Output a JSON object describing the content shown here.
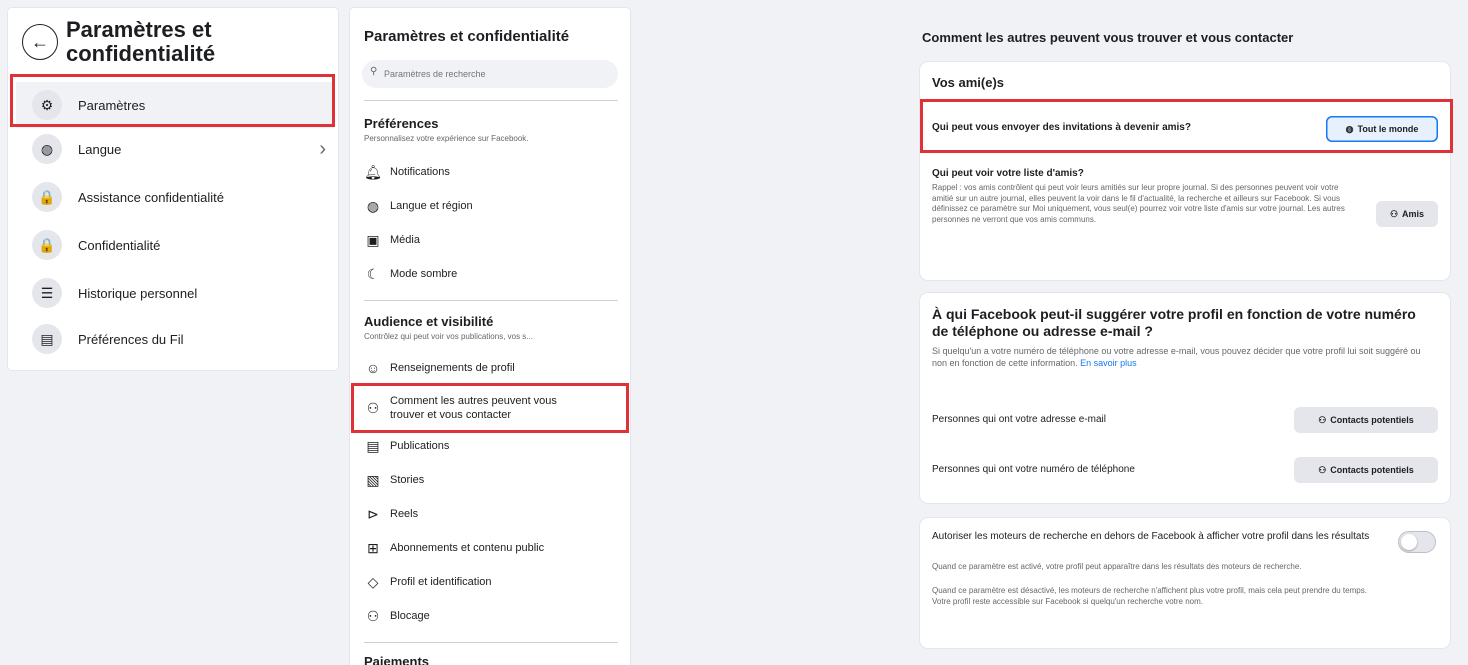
{
  "left": {
    "title": "Paramètres et confidentialité",
    "items": [
      {
        "label": "Paramètres",
        "icon": "gear-icon",
        "glyph": "⚙"
      },
      {
        "label": "Langue",
        "icon": "globe-icon",
        "glyph": "🌐"
      },
      {
        "label": "Assistance confidentialité",
        "icon": "lock-plus-icon",
        "glyph": "🔒"
      },
      {
        "label": "Confidentialité",
        "icon": "lock-icon",
        "glyph": "🔒"
      },
      {
        "label": "Historique personnel",
        "icon": "list-icon",
        "glyph": "☰"
      },
      {
        "label": "Préférences du Fil",
        "icon": "feed-icon",
        "glyph": "▤"
      }
    ]
  },
  "middle": {
    "title": "Paramètres et confidentialité",
    "search_placeholder": "Paramètres de recherche",
    "preferences": {
      "title": "Préférences",
      "subtitle": "Personnalisez votre expérience sur Facebook.",
      "items": [
        {
          "label": "Notifications",
          "icon": "bell-icon",
          "glyph": "🔔"
        },
        {
          "label": "Langue et région",
          "icon": "globe-icon",
          "glyph": "🌐"
        },
        {
          "label": "Média",
          "icon": "media-icon",
          "glyph": "▣"
        },
        {
          "label": "Mode sombre",
          "icon": "moon-icon",
          "glyph": "☾"
        }
      ]
    },
    "audience": {
      "title": "Audience et visibilité",
      "subtitle": "Contrôlez qui peut voir vos publications, vos s...",
      "items": [
        {
          "label": "Renseignements de profil",
          "icon": "profile-icon",
          "glyph": "☺"
        },
        {
          "label": "Comment les autres peuvent vous trouver et vous contacter",
          "icon": "person-add-icon",
          "glyph": "👤"
        },
        {
          "label": "Publications",
          "icon": "posts-icon",
          "glyph": "▤"
        },
        {
          "label": "Stories",
          "icon": "stories-icon",
          "glyph": "▧"
        },
        {
          "label": "Reels",
          "icon": "reels-icon",
          "glyph": "▶"
        },
        {
          "label": "Abonnements et contenu public",
          "icon": "follow-icon",
          "glyph": "⊞"
        },
        {
          "label": "Profil et identification",
          "icon": "tag-icon",
          "glyph": "◇"
        },
        {
          "label": "Blocage",
          "icon": "block-icon",
          "glyph": "👤"
        }
      ]
    },
    "payments": {
      "title": "Paiements"
    }
  },
  "content": {
    "title": "Comment les autres peuvent vous trouver et vous contacter",
    "friends_card": {
      "header": "Vos ami(e)s",
      "q1": "Qui peut vous envoyer des invitations à devenir amis?",
      "q1_value": "Tout le monde",
      "q2": "Qui peut voir votre liste d'amis?",
      "q2_desc": "Rappel : vos amis contrôlent qui peut voir leurs amitiés sur leur propre journal. Si des personnes peuvent voir votre amitié sur un autre journal, elles peuvent la voir dans le fil d'actualité, la recherche et ailleurs sur Facebook. Si vous définissez ce paramètre sur Moi uniquement, vous seul(e) pourrez voir votre liste d'amis sur votre journal. Les autres personnes ne verront que vos amis communs.",
      "q2_value": "Amis"
    },
    "suggest_card": {
      "header": "À qui Facebook peut-il suggérer votre profil en fonction de votre numéro de téléphone ou adresse e-mail ?",
      "desc": "Si quelqu'un a votre numéro de téléphone ou votre adresse e-mail, vous pouvez décider que votre profil lui soit suggéré ou non en fonction de cette information.",
      "link": "En savoir plus",
      "email_label": "Personnes qui ont votre adresse e-mail",
      "email_value": "Contacts potentiels",
      "phone_label": "Personnes qui ont votre numéro de téléphone",
      "phone_value": "Contacts potentiels"
    },
    "search_card": {
      "label": "Autoriser les moteurs de recherche en dehors de Facebook à afficher votre profil dans les résultats",
      "desc1": "Quand ce paramètre est activé, votre profil peut apparaître dans les résultats des moteurs de recherche.",
      "desc2": "Quand ce paramètre est désactivé, les moteurs de recherche n'affichent plus votre profil, mais cela peut prendre du temps. Votre profil reste accessible sur Facebook si quelqu'un recherche votre nom.",
      "toggle_on": false
    }
  },
  "colors": {
    "highlight": "#e03137",
    "accent": "#1877f2"
  }
}
